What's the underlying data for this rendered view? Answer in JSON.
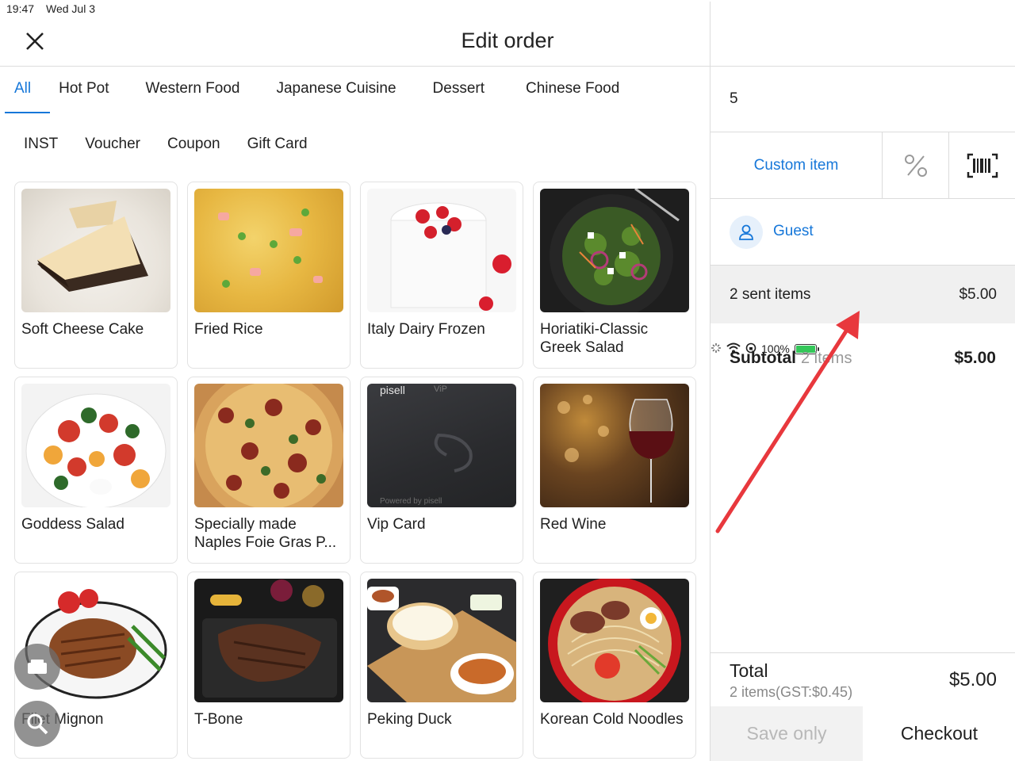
{
  "status_bar": {
    "time": "19:47",
    "date": "Wed Jul 3",
    "battery": "100%"
  },
  "header": {
    "title": "Edit order"
  },
  "categories": {
    "row1": [
      "All",
      "Hot Pot",
      "Western Food",
      "Japanese Cuisine",
      "Dessert",
      "Chinese Food"
    ],
    "row2": [
      "INST",
      "Voucher",
      "Coupon",
      "Gift Card"
    ],
    "active": "All"
  },
  "products": [
    {
      "name": "Soft Cheese Cake"
    },
    {
      "name": "Fried Rice"
    },
    {
      "name": "Italy Dairy Frozen"
    },
    {
      "name": "Horiatiki-Classic Greek Salad"
    },
    {
      "name": "Goddess Salad"
    },
    {
      "name": "Specially made Naples Foie Gras P..."
    },
    {
      "name": "Vip Card",
      "card_brand": "pisell",
      "card_tier": "ViP",
      "card_footer": "Powered by pisell"
    },
    {
      "name": "Red Wine"
    },
    {
      "name": "Filet Mignon"
    },
    {
      "name": "T-Bone"
    },
    {
      "name": "Peking Duck"
    },
    {
      "name": "Korean Cold Noodles"
    }
  ],
  "order": {
    "number": "5",
    "custom_item_label": "Custom item",
    "guest_label": "Guest",
    "sent_items_label": "2 sent items",
    "sent_items_value": "$5.00",
    "subtotal_label": "Subtotal",
    "subtotal_count": "2 items",
    "subtotal_value": "$5.00",
    "total_label": "Total",
    "total_sub": "2 items(GST:$0.45)",
    "total_value": "$5.00",
    "save_only_label": "Save only",
    "checkout_label": "Checkout"
  },
  "colors": {
    "accent": "#1677d9",
    "annotation_arrow": "#e8383d"
  }
}
